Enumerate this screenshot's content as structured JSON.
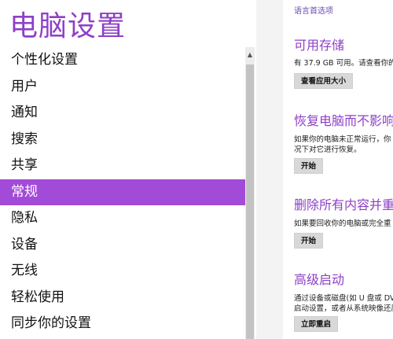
{
  "app_title": "电脑设置",
  "nav_items": [
    {
      "label": "个性化设置",
      "selected": false
    },
    {
      "label": "用户",
      "selected": false
    },
    {
      "label": "通知",
      "selected": false
    },
    {
      "label": "搜索",
      "selected": false
    },
    {
      "label": "共享",
      "selected": false
    },
    {
      "label": "常规",
      "selected": true
    },
    {
      "label": "隐私",
      "selected": false
    },
    {
      "label": "设备",
      "selected": false
    },
    {
      "label": "无线",
      "selected": false
    },
    {
      "label": "轻松使用",
      "selected": false
    },
    {
      "label": "同步你的设置",
      "selected": false
    }
  ],
  "content": {
    "top_link": "语言首选项",
    "sections": [
      {
        "title": "可用存储",
        "desc_lines": [
          "有 37.9 GB 可用。请查看你的"
        ],
        "button": "查看应用大小"
      },
      {
        "title": "恢复电脑而不影响",
        "desc_lines": [
          "如果你的电脑未正常运行，你",
          "况下对它进行恢复。"
        ],
        "button": "开始"
      },
      {
        "title": "删除所有内容并重",
        "desc_lines": [
          "如果要回收你的电脑或完全重"
        ],
        "button": "开始"
      },
      {
        "title": "高级启动",
        "desc_lines": [
          "通过设备或磁盘(如 U 盘或 DV",
          "启动设置，或者从系统映像还原"
        ],
        "button": "立即重启"
      }
    ]
  },
  "colors": {
    "accent": "#8e3fc7",
    "selected_bg": "#a24bd8"
  }
}
